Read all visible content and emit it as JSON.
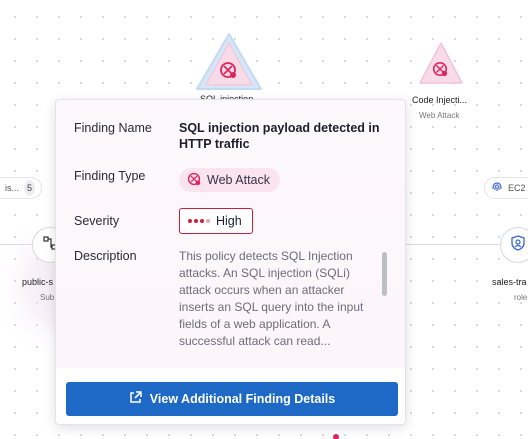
{
  "graph": {
    "sql_node": {
      "title": "SQL injection",
      "icon": "bug-shield-icon"
    },
    "code_node": {
      "title": "Code Injecti...",
      "subtitle": "Web Attack",
      "icon": "bug-shield-icon"
    },
    "left_chip": {
      "label": "is...",
      "count": "5"
    },
    "right_chip": {
      "label": "EC2",
      "icon": "fingerprint-icon"
    },
    "public_node": {
      "title": "public-s",
      "subtitle": "Sub"
    },
    "sales_node": {
      "title": "sales-tra",
      "subtitle": "role"
    }
  },
  "popup": {
    "finding_name": {
      "label": "Finding Name",
      "value": "SQL injection payload detected in HTTP traffic"
    },
    "finding_type": {
      "label": "Finding Type",
      "value": "Web Attack",
      "icon": "bug-shield-icon"
    },
    "severity": {
      "label": "Severity",
      "value": "High",
      "color": "#c8213b"
    },
    "description": {
      "label": "Description",
      "value": "This policy detects SQL Injection attacks. An SQL injection (SQLi) attack occurs when an attacker inserts an SQL query into the input fields of a web application. A successful attack can read..."
    },
    "action_button": {
      "label": "View Additional Finding Details",
      "icon": "external-link-icon"
    }
  },
  "colors": {
    "accent": "#1e68c6",
    "attack_pink": "#e0245e",
    "severity_red": "#c8213b"
  }
}
